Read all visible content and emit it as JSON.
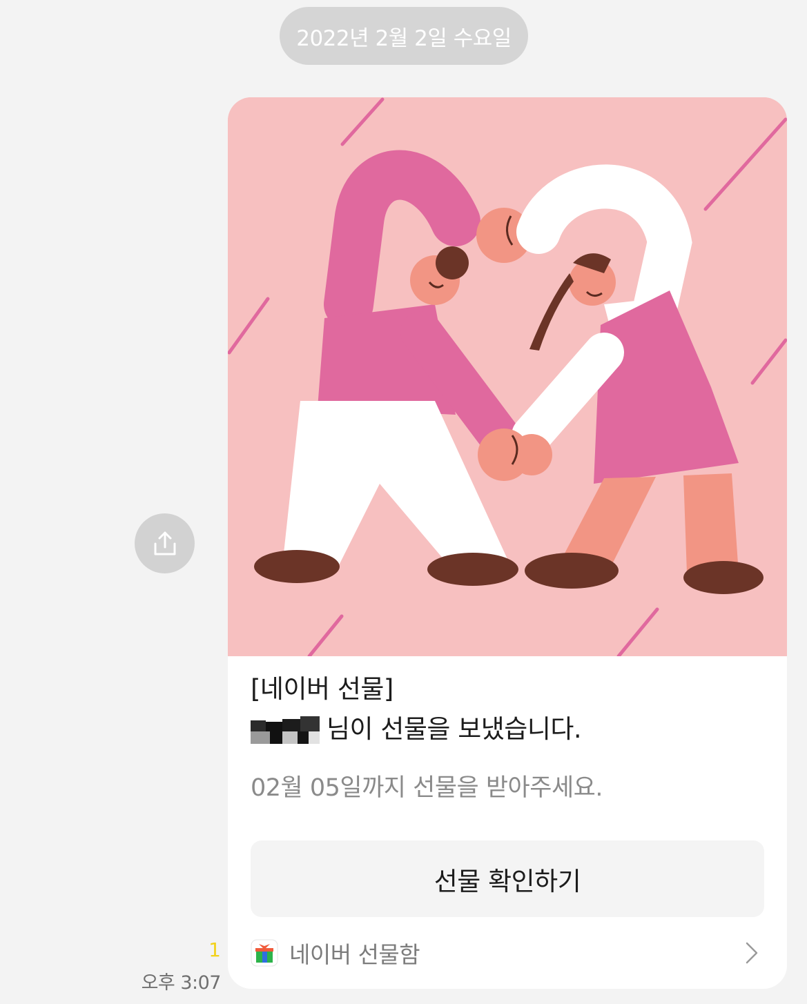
{
  "date_divider": "2022년 2월 2일 수요일",
  "message": {
    "unread_count": "1",
    "time": "오후 3:07"
  },
  "card": {
    "title": "[네이버 선물]",
    "sender_suffix": "님이 선물을 보냈습니다.",
    "deadline": "02월 05일까지 선물을 받아주세요.",
    "button_label": "선물 확인하기",
    "footer_label": "네이버 선물함"
  },
  "icons": {
    "share": "share-upload-icon",
    "gift_box": "gift-box-icon",
    "chevron": "chevron-right-icon"
  },
  "colors": {
    "background": "#f3f3f3",
    "date_pill": "#d5d5d5",
    "unread": "#f2d21b",
    "card_image_bg": "#f7c0c0",
    "pink_clothing": "#e0699e",
    "skin": "#f29584",
    "hair_shoes": "#6b3427"
  }
}
